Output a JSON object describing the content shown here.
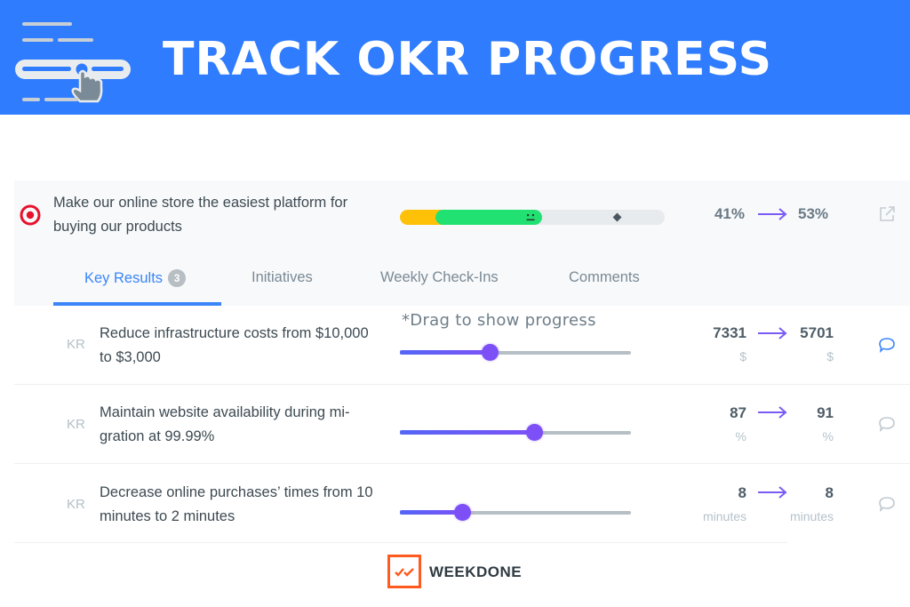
{
  "banner": {
    "title": "TRACK OKR PROGRESS",
    "icon": "slider-hand-pointer-icon",
    "background_color": "#2f7cfe"
  },
  "objective": {
    "icon": "target-icon",
    "title": "Make our online store the easiest platform for buying our products",
    "progress": {
      "previous_percent": 41,
      "current_percent": 53,
      "expected_marker_percent": 82,
      "status_face": "neutral-face-icon",
      "colors": {
        "previous": "#ffc107",
        "gain": "#22e173",
        "track": "#e8ebee"
      }
    },
    "from_label": "41%",
    "to_label": "53%",
    "arrow_icon": "arrow-right-icon",
    "open_icon": "external-link-icon"
  },
  "tabs": [
    {
      "label": "Key Results",
      "badge": "3",
      "active": true
    },
    {
      "label": "Initiatives",
      "active": false
    },
    {
      "label": "Weekly Check-Ins",
      "active": false
    },
    {
      "label": "Comments",
      "active": false
    }
  ],
  "drag_hint": "*Drag to show progress",
  "key_results": [
    {
      "label": "KR",
      "title": "Reduce infrastructure costs from $10,000 to $3,000",
      "slider_fraction": 0.39,
      "from_value": "7331",
      "to_value": "5701",
      "from_unit": "$",
      "to_unit": "$",
      "comment_icon_active": true
    },
    {
      "label": "KR",
      "title": "Maintain website availability during mi-gration at 99.99%",
      "slider_fraction": 0.58,
      "from_value": "87",
      "to_value": "91",
      "from_unit": "%",
      "to_unit": "%",
      "comment_icon_active": false
    },
    {
      "label": "KR",
      "title": "Decrease online purchases’ times from 10 minutes to 2 minutes",
      "slider_fraction": 0.27,
      "from_value": "8",
      "to_value": "8",
      "from_unit": "minutes",
      "to_unit": "minutes",
      "comment_icon_active": false
    }
  ],
  "footer": {
    "brand": "WEEKDONE",
    "brand_icon": "double-check-icon",
    "brand_color": "#ff5a1f"
  },
  "accent_colors": {
    "tab_active": "#3a86f8",
    "slider": "#7d4ff6",
    "arrow": "#7a5cf5",
    "target": "#e8112d"
  }
}
